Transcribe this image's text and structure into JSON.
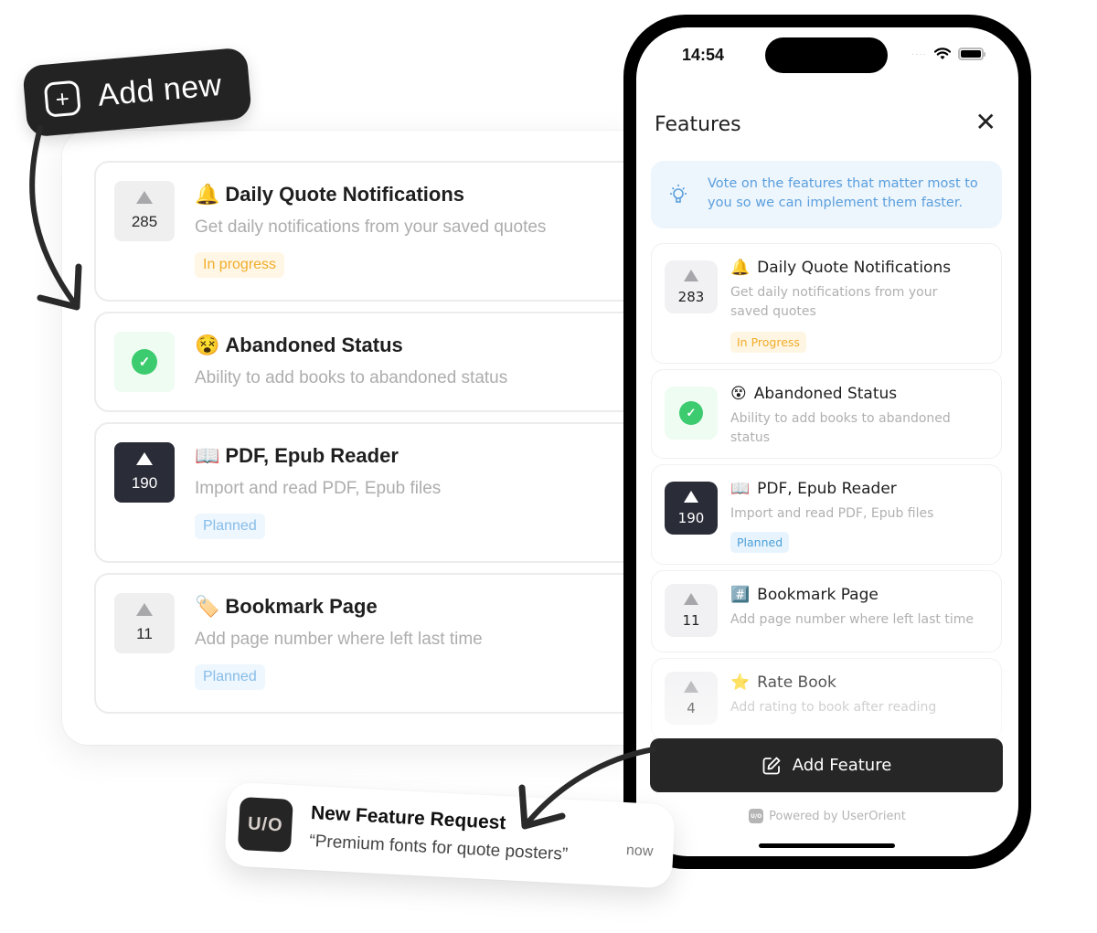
{
  "add_new": {
    "label": "Add new",
    "icon": "plus-square-icon"
  },
  "left_panel": {
    "items": [
      {
        "emoji": "🔔",
        "title": "Daily Quote Notifications",
        "description": "Get daily notifications from your saved quotes",
        "votes": "285",
        "status": "In progress",
        "state": "default"
      },
      {
        "emoji": "😵",
        "title": "Abandoned Status",
        "description": "Ability to add books to abandoned status",
        "votes": "",
        "status": "",
        "state": "completed"
      },
      {
        "emoji": "📖",
        "title": "PDF, Epub Reader",
        "description": "Import and read PDF, Epub files",
        "votes": "190",
        "status": "Planned",
        "state": "voted"
      },
      {
        "emoji": "🏷️",
        "title": "Bookmark Page",
        "description": "Add page number where left last time",
        "votes": "11",
        "status": "Planned",
        "state": "default"
      }
    ]
  },
  "phone": {
    "status_bar": {
      "time": "14:54",
      "signal": "····"
    },
    "header": {
      "title": "Features",
      "close_icon": "✕"
    },
    "info": {
      "text": "Vote on the features that matter most to you so we can implement them faster."
    },
    "items": [
      {
        "emoji": "🔔",
        "title": "Daily Quote Notifications",
        "description": "Get daily notifications from your saved quotes",
        "votes": "283",
        "status": "In Progress",
        "state": "default"
      },
      {
        "emoji": "😵",
        "title": "Abandoned Status",
        "description": "Ability to add books to abandoned status",
        "votes": "",
        "status": "",
        "state": "completed"
      },
      {
        "emoji": "📖",
        "title": "PDF, Epub Reader",
        "description": "Import and read PDF, Epub files",
        "votes": "190",
        "status": "Planned",
        "state": "voted"
      },
      {
        "emoji": "#️⃣",
        "title": "Bookmark Page",
        "description": "Add page number where left last time",
        "votes": "11",
        "status": "",
        "state": "default"
      },
      {
        "emoji": "⭐",
        "title": "Rate Book",
        "description": "Add rating to book after reading",
        "votes": "4",
        "status": "",
        "state": "default"
      }
    ],
    "add_feature_label": "Add Feature",
    "powered_by": "Powered by UserOrient",
    "powered_logo": "U/O"
  },
  "notification": {
    "logo": "U/O",
    "title": "New Feature Request",
    "body": "“Premium fonts for quote posters”",
    "time": "now"
  },
  "colors": {
    "dark": "#262626",
    "in_progress": "#f0ad2a",
    "planned": "#4a9fd8",
    "completed": "#3dcb6f",
    "info_text": "#5b9fdc"
  }
}
